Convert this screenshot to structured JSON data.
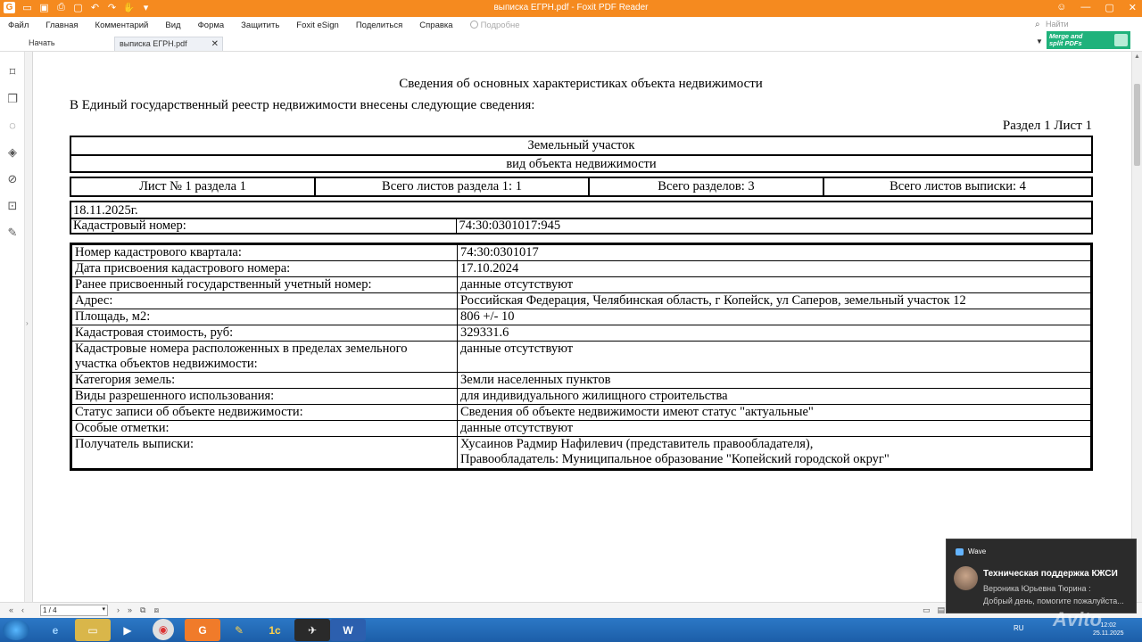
{
  "window": {
    "title": "выписка ЕГРН.pdf - Foxit PDF Reader",
    "app_color": "#f58a1f"
  },
  "menu": {
    "items": [
      "Файл",
      "Главная",
      "Комментарий",
      "Вид",
      "Форма",
      "Защитить",
      "Foxit eSign",
      "Поделиться",
      "Справка"
    ],
    "tell_me": "Подробне",
    "search_placeholder": "Найти"
  },
  "tabs": [
    {
      "label": "Начать"
    },
    {
      "label": "выписка ЕГРН.pdf",
      "active": true
    }
  ],
  "promo": {
    "line1": "Merge and",
    "line2": "split PDFs"
  },
  "document": {
    "title": "Сведения об основных характеристиках объекта недвижимости",
    "intro": "В Единый государственный реестр недвижимости внесены следующие сведения:",
    "section": "Раздел 1 Лист 1",
    "object_type": "Земельный участок",
    "object_type_caption": "вид объекта недвижимости",
    "sheet_info": [
      "Лист № 1 раздела 1",
      "Всего листов раздела 1: 1",
      "Всего разделов: 3",
      "Всего листов выписки: 4"
    ],
    "date": "18.11.2025г.",
    "cadastral": {
      "label": "Кадастровый номер:",
      "value": "74:30:0301017:945"
    },
    "rows": [
      {
        "label": "Номер кадастрового квартала:",
        "value": "74:30:0301017"
      },
      {
        "label": "Дата присвоения кадастрового номера:",
        "value": "17.10.2024"
      },
      {
        "label": "Ранее присвоенный государственный учетный номер:",
        "value": "данные отсутствуют"
      },
      {
        "label": "Адрес:",
        "value": "Российская Федерация, Челябинская область, г Копейск, ул Саперов, земельный участок 12"
      },
      {
        "label": "Площадь, м2:",
        "value": "806 +/- 10"
      },
      {
        "label": "Кадастровая стоимость, руб:",
        "value": "329331.6"
      },
      {
        "label": "Кадастровые номера расположенных в пределах земельного",
        "label2": "участка объектов недвижимости:",
        "value": "данные отсутствуют"
      },
      {
        "label": "Категория земель:",
        "value": "Земли населенных пунктов"
      },
      {
        "label": "Виды разрешенного использования:",
        "value": "для индивидуального жилищного строительства"
      },
      {
        "label": "Статус записи об объекте недвижимости:",
        "value": "Сведения об объекте недвижимости имеют статус \"актуальные\""
      },
      {
        "label": "Особые отметки:",
        "value": "данные отсутствуют"
      },
      {
        "label": "Получатель выписки:",
        "value": "Хусаинов Радмир Нафилевич (представитель правообладателя),",
        "value2": "Правообладатель: Муниципальное образование \"Копейский городской округ\""
      }
    ]
  },
  "statusbar": {
    "page": "1 / 4"
  },
  "taskbar": {
    "lang": "RU",
    "time": "12:02",
    "date": "25.11.2025"
  },
  "notification": {
    "app": "Wave",
    "title": "Техническая поддержка КЖСИ",
    "sender": "Вероника Юрьевна Тюрина :",
    "message": "Добрый день, помогите пожалуйста..."
  },
  "watermark": "Avito"
}
